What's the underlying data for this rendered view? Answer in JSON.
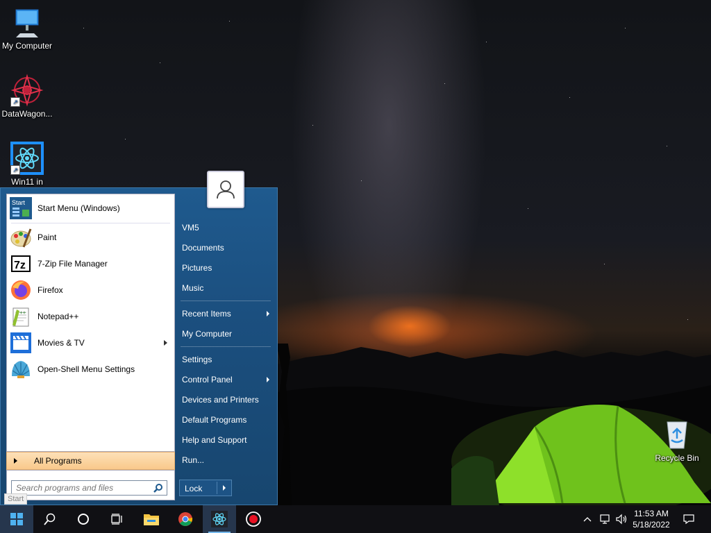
{
  "desktop": {
    "icons": [
      {
        "label": "My Computer"
      },
      {
        "label": "DataWagon..."
      },
      {
        "label": "Win11 in"
      },
      {
        "label": "Recycle Bin"
      }
    ]
  },
  "start_menu": {
    "pinned": [
      {
        "label": "Start Menu (Windows)",
        "icon": "start-menu-icon"
      }
    ],
    "programs": [
      {
        "label": "Paint",
        "icon": "paint-icon"
      },
      {
        "label": "7-Zip File Manager",
        "icon": "7zip-icon"
      },
      {
        "label": "Firefox",
        "icon": "firefox-icon"
      },
      {
        "label": "Notepad++",
        "icon": "notepadpp-icon"
      },
      {
        "label": "Movies & TV",
        "icon": "movies-tv-icon",
        "submenu": true
      },
      {
        "label": "Open-Shell Menu Settings",
        "icon": "open-shell-icon"
      }
    ],
    "all_programs_label": "All Programs",
    "search_placeholder": "Search programs and files",
    "right_items": [
      {
        "label": "VM5"
      },
      {
        "label": "Documents"
      },
      {
        "label": "Pictures"
      },
      {
        "label": "Music"
      },
      {
        "label": "Recent Items",
        "submenu": true
      },
      {
        "label": "My Computer"
      },
      {
        "label": "Settings"
      },
      {
        "label": "Control Panel",
        "submenu": true
      },
      {
        "label": "Devices and Printers"
      },
      {
        "label": "Default Programs"
      },
      {
        "label": "Help and Support"
      },
      {
        "label": "Run..."
      }
    ],
    "lock_label": "Lock",
    "start_tooltip": "Start"
  },
  "taskbar": {
    "apps": [
      "windows-start-icon",
      "search-icon",
      "cortana-icon",
      "task-view-icon",
      "file-explorer-icon",
      "chrome-icon",
      "react-app-icon",
      "record-icon"
    ],
    "clock_time": "11:53 AM",
    "clock_date": "5/18/2022"
  },
  "colors": {
    "menu_blue": "#1b4f7f",
    "all_programs_highlight": "#f9c98b",
    "taskbar": "#101014"
  }
}
